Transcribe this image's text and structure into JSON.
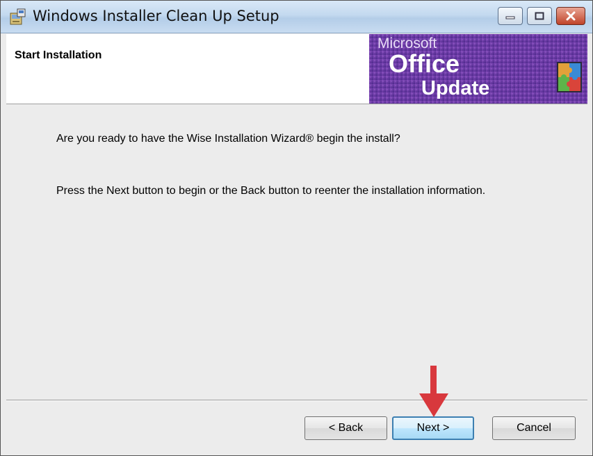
{
  "window": {
    "title": "Windows Installer Clean Up Setup"
  },
  "header": {
    "title": "Start Installation",
    "banner": {
      "line1": "Microsoft",
      "line2": "Office",
      "line3": "Update",
      "color": "#6b3aa0"
    }
  },
  "body": {
    "text1": "Are you ready to have the Wise Installation Wizard® begin the install?",
    "text2": "Press the Next button to begin or the Back button to reenter the installation information."
  },
  "buttons": {
    "back": "< Back",
    "next": "Next >",
    "cancel": "Cancel"
  },
  "annotation": {
    "arrow_color": "#d8383d"
  }
}
